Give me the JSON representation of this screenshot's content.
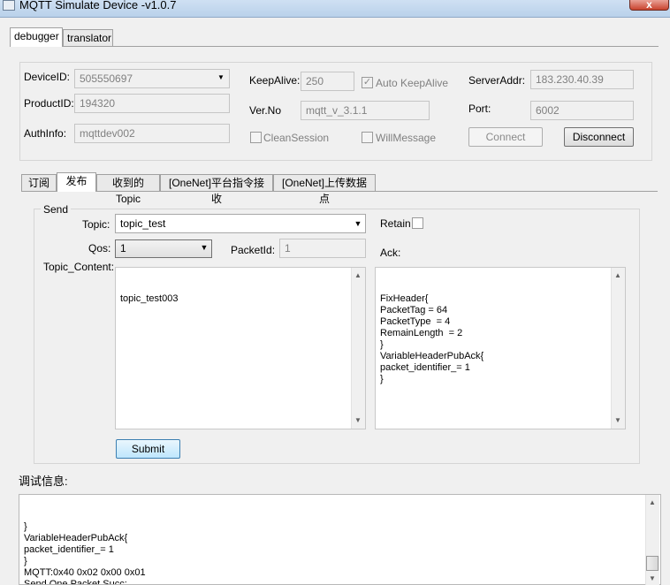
{
  "window": {
    "title": "MQTT Simulate Device  -v1.0.7",
    "close_label": "x"
  },
  "top_tabs": [
    {
      "label": "debugger"
    },
    {
      "label": "translator"
    }
  ],
  "connection": {
    "device_id_label": "DeviceID:",
    "device_id": "505550697",
    "product_id_label": "ProductID:",
    "product_id": "194320",
    "auth_info_label": "AuthInfo:",
    "auth_info": "mqttdev002",
    "keepalive_label": "KeepAlive:",
    "keepalive": "250",
    "auto_keepalive_label": "Auto KeepAlive",
    "auto_keepalive_checked": true,
    "version_label": "Ver.No",
    "version": "mqtt_v_3.1.1",
    "clean_session_label": "CleanSession",
    "will_message_label": "WillMessage",
    "server_addr_label": "ServerAddr:",
    "server_addr": "183.230.40.39",
    "port_label": "Port:",
    "port": "6002",
    "connect_label": "Connect",
    "disconnect_label": "Disconnect"
  },
  "sub_tabs": [
    {
      "label": "订阅"
    },
    {
      "label": "发布"
    },
    {
      "label": "收到的Topic"
    },
    {
      "label": "[OneNet]平台指令接收"
    },
    {
      "label": "[OneNet]上传数据点"
    }
  ],
  "send": {
    "group_label": "Send",
    "topic_label": "Topic:",
    "topic": "topic_test",
    "retain_label": "Retain",
    "qos_label": "Qos:",
    "qos": "1",
    "packet_id_label": "PacketId:",
    "packet_id": "1",
    "ack_label": "Ack:",
    "content_label": "Topic_Content:",
    "content": "topic_test003",
    "ack_text": "FixHeader{\nPacketTag = 64\nPacketType  = 4\nRemainLength  = 2\n}\nVariableHeaderPubAck{\npacket_identifier_= 1\n}",
    "submit_label": "Submit"
  },
  "debug": {
    "label": "调试信息:",
    "log": "}\nVariableHeaderPubAck{\npacket_identifier_= 1\n}\nMQTT:0x40 0x02 0x00 0x01\nSend One Packet Succ:"
  },
  "icons": {
    "dropdown": "▼",
    "scroll_up": "▲",
    "scroll_down": "▼",
    "check": "✓"
  }
}
